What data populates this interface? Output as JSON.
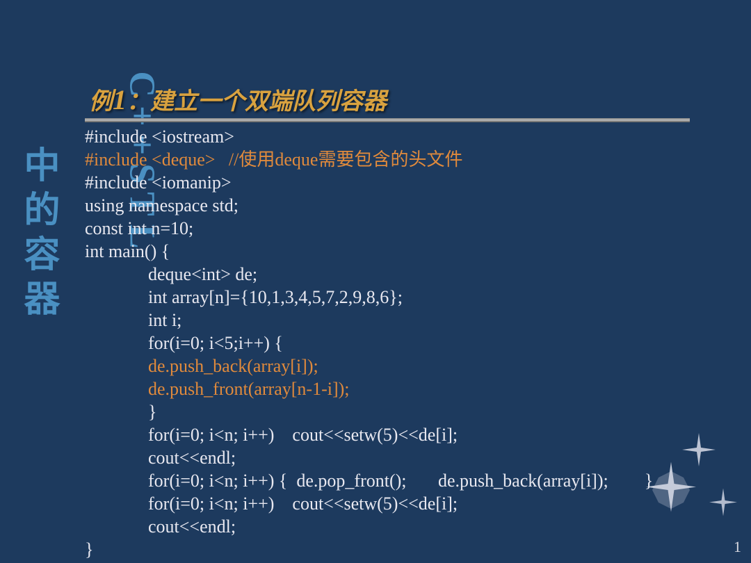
{
  "sidebar": {
    "latin": "C++STL",
    "cjk": "中的容器"
  },
  "heading": {
    "prefix": "例",
    "num": "1",
    "suffix": "：建立一个双端队列容器"
  },
  "code": {
    "l1": "#include <iostream>",
    "l2": "#include <deque>   //使用deque需要包含的头文件",
    "l3": "#include <iomanip>",
    "l4": "using namespace std;",
    "l5": "const int n=10;",
    "l6": "int main() {",
    "l7": "              deque<int> de;",
    "l8": "              int array[n]={10,1,3,4,5,7,2,9,8,6};",
    "l9": "              int i;",
    "l10": "              for(i=0; i<5;i++) {",
    "l11": "              de.push_back(array[i]);",
    "l12": "              de.push_front(array[n-1-i]);",
    "l13": "              }",
    "l14": "              for(i=0; i<n; i++)    cout<<setw(5)<<de[i];",
    "l15": "              cout<<endl;",
    "l16": "              for(i=0; i<n; i++) {  de.pop_front();       de.push_back(array[i]);        }",
    "l17": "              for(i=0; i<n; i++)    cout<<setw(5)<<de[i];",
    "l18": "              cout<<endl;",
    "l19": "}"
  },
  "page_number": "1"
}
